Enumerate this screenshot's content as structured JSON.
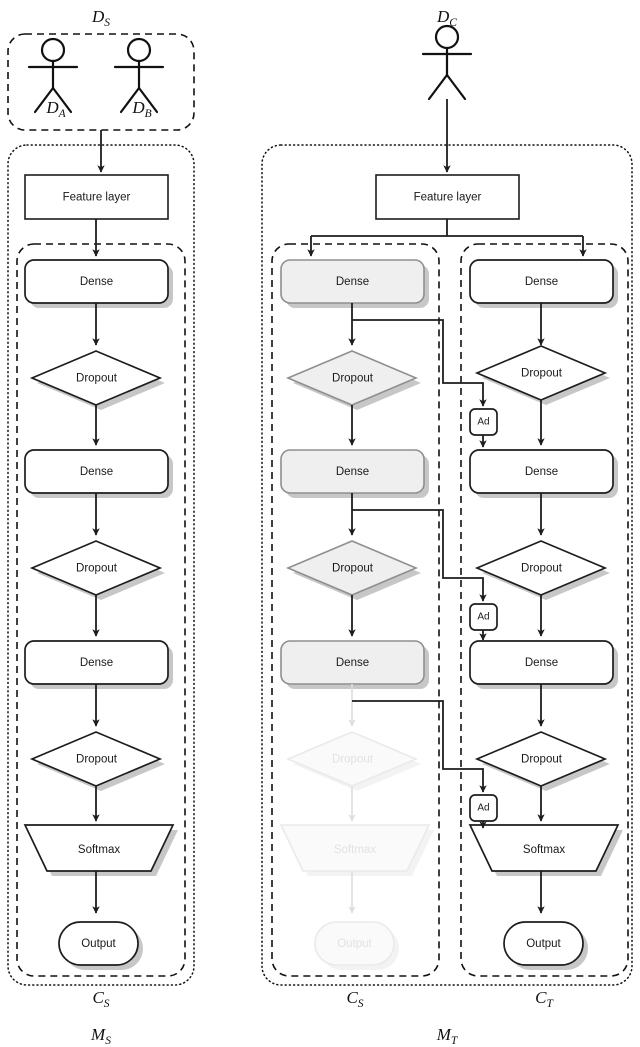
{
  "figure": {
    "title_absent": true,
    "groups": [
      {
        "id": "ds",
        "label": "D",
        "sub": "S",
        "name": "source-dataset-group"
      },
      {
        "id": "dc",
        "label": "D",
        "sub": "C",
        "name": "combined-dataset-group"
      },
      {
        "id": "ms",
        "label": "M",
        "sub": "S",
        "name": "source-model-group"
      },
      {
        "id": "mt",
        "label": "M",
        "sub": "T",
        "name": "target-model-group"
      },
      {
        "id": "cs_left",
        "label": "C",
        "sub": "S",
        "name": "source-classifier-left"
      },
      {
        "id": "cs_mid",
        "label": "C",
        "sub": "S",
        "name": "source-classifier-mid"
      },
      {
        "id": "ct",
        "label": "C",
        "sub": "T",
        "name": "target-classifier"
      }
    ],
    "actors": [
      {
        "id": "da",
        "label": "D",
        "sub": "A",
        "name": "actor-dataset-a"
      },
      {
        "id": "db",
        "label": "D",
        "sub": "B",
        "name": "actor-dataset-b"
      },
      {
        "id": "dc_actor",
        "label": "D",
        "sub": "C",
        "name": "actor-dataset-c"
      }
    ],
    "labels": {
      "feature_layer": "Feature layer",
      "dense": "Dense",
      "dropout": "Dropout",
      "softmax": "Softmax",
      "output": "Output",
      "adapter": "Ad"
    },
    "columns": {
      "left": {
        "name": "source-model-column",
        "feature_layer": "Feature layer",
        "blocks": [
          "Dense",
          "Dropout",
          "Dense",
          "Dropout",
          "Dense",
          "Dropout",
          "Softmax",
          "Output"
        ]
      },
      "middle": {
        "name": "frozen-source-classifier-column",
        "blocks": [
          "Dense",
          "Dropout",
          "Dense",
          "Dropout",
          "Dense",
          "Dropout",
          "Softmax",
          "Output"
        ],
        "frozen": true,
        "faded_from_index": 5
      },
      "right": {
        "name": "target-classifier-column",
        "blocks": [
          "Dense",
          "Dropout",
          "Dense",
          "Dropout",
          "Dense",
          "Dropout",
          "Softmax",
          "Output"
        ],
        "adapters": [
          "Ad",
          "Ad",
          "Ad"
        ]
      }
    },
    "colors": {
      "stroke": "#1d1d1d",
      "frozen_fill": "#efefef",
      "frozen_stroke": "#8f8f8f",
      "shadow": "#bdbdbd",
      "ghost": "#e2e2e2",
      "background": "#ffffff"
    }
  }
}
